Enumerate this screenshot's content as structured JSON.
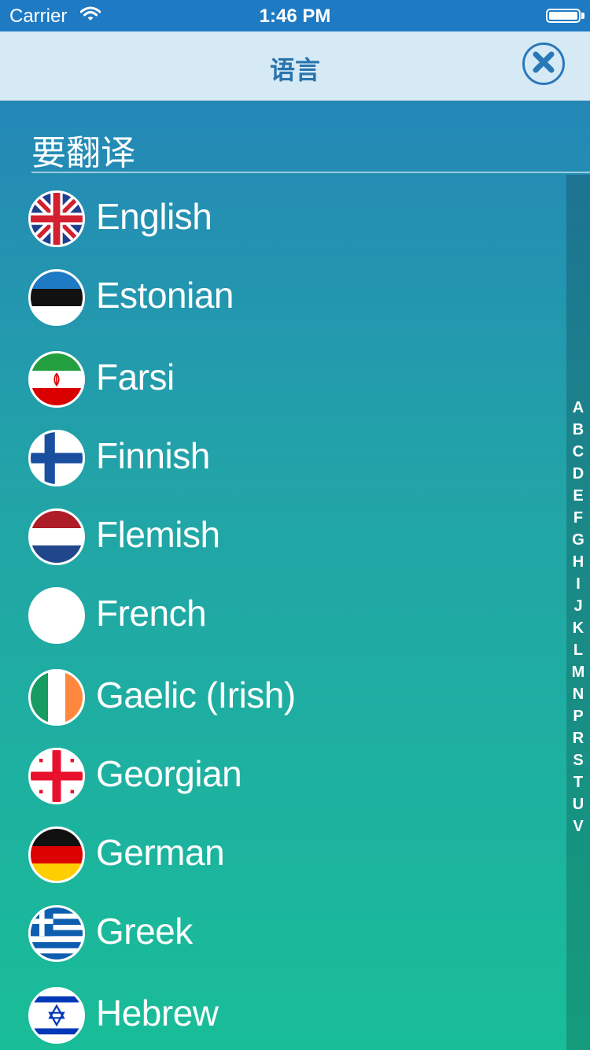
{
  "status_bar": {
    "carrier": "Carrier",
    "time": "1:46 PM"
  },
  "nav": {
    "title": "语言",
    "close_icon": "close-icon"
  },
  "section": {
    "title": "要翻译"
  },
  "languages": [
    {
      "name": "English",
      "flag": "uk-flag"
    },
    {
      "name": "Estonian",
      "flag": "estonia-flag"
    },
    {
      "name": "Farsi",
      "flag": "iran-flag"
    },
    {
      "name": "Finnish",
      "flag": "finland-flag"
    },
    {
      "name": "Flemish",
      "flag": "netherlands-flag"
    },
    {
      "name": "French",
      "flag": "blank-flag"
    },
    {
      "name": "Gaelic (Irish)",
      "flag": "ireland-flag"
    },
    {
      "name": "Georgian",
      "flag": "georgia-flag"
    },
    {
      "name": "German",
      "flag": "germany-flag"
    },
    {
      "name": "Greek",
      "flag": "greece-flag"
    },
    {
      "name": "Hebrew",
      "flag": "israel-flag"
    }
  ],
  "index_letters": [
    "A",
    "B",
    "C",
    "D",
    "E",
    "F",
    "G",
    "H",
    "I",
    "J",
    "K",
    "L",
    "M",
    "N",
    "P",
    "R",
    "S",
    "T",
    "U",
    "V"
  ],
  "colors": {
    "status_bar": "#1f7ac4",
    "nav_bar": "#d6eaf6",
    "accent": "#2b78b8"
  }
}
